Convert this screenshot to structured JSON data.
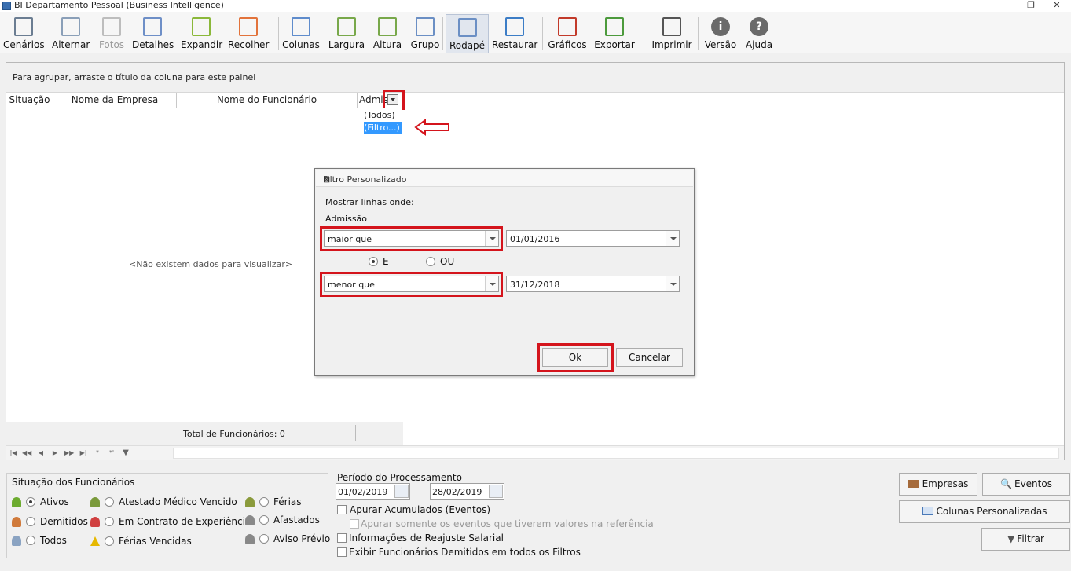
{
  "window": {
    "title": "BI Departamento Pessoal  (Business Intelligence)"
  },
  "toolbar": {
    "items": [
      {
        "label": "Cenários",
        "icon": "scenarios-icon"
      },
      {
        "label": "Alternar",
        "icon": "toggle-icon"
      },
      {
        "label": "Fotos",
        "icon": "photos-icon"
      },
      {
        "label": "Detalhes",
        "icon": "details-icon"
      },
      {
        "label": "Expandir",
        "icon": "expand-icon"
      },
      {
        "label": "Recolher",
        "icon": "collapse-icon"
      },
      {
        "label": "Colunas",
        "icon": "columns-icon"
      },
      {
        "label": "Largura",
        "icon": "width-icon"
      },
      {
        "label": "Altura",
        "icon": "height-icon"
      },
      {
        "label": "Grupo",
        "icon": "group-icon"
      },
      {
        "label": "Rodapé",
        "icon": "footer-icon"
      },
      {
        "label": "Restaurar",
        "icon": "restore-icon"
      },
      {
        "label": "Gráficos",
        "icon": "charts-icon"
      },
      {
        "label": "Exportar",
        "icon": "export-icon"
      },
      {
        "label": "Imprimir",
        "icon": "print-icon"
      },
      {
        "label": "Versão",
        "icon": "info-icon"
      },
      {
        "label": "Ajuda",
        "icon": "help-icon"
      }
    ]
  },
  "grid": {
    "group_panel_text": "Para agrupar, arraste o título da coluna para este painel",
    "columns": [
      "Situação",
      "Nome da Empresa",
      "Nome do Funcionário",
      "Admis"
    ],
    "filter_dropdown": [
      "(Todos)",
      "(Filtro...)"
    ],
    "empty_text": "<Não existem dados para visualizar>",
    "footer_text": "Total de Funcionários: 0"
  },
  "dialog": {
    "title": "Filtro Personalizado",
    "show_rows_label": "Mostrar linhas onde:",
    "field_label": "Admissão",
    "condition1": {
      "operator": "maior que",
      "value": "01/01/2016"
    },
    "logic": {
      "and_label": "E",
      "or_label": "OU",
      "selected": "E"
    },
    "condition2": {
      "operator": "menor que",
      "value": "31/12/2018"
    },
    "ok_label": "Ok",
    "cancel_label": "Cancelar"
  },
  "status_group": {
    "title": "Situação dos Funcionários",
    "options": [
      {
        "label": "Ativos",
        "selected": true
      },
      {
        "label": "Demitidos",
        "selected": false
      },
      {
        "label": "Todos",
        "selected": false
      },
      {
        "label": "Atestado Médico Vencido",
        "selected": false
      },
      {
        "label": "Em Contrato de Experiência",
        "selected": false
      },
      {
        "label": "Férias Vencidas",
        "selected": false
      },
      {
        "label": "Férias",
        "selected": false
      },
      {
        "label": "Afastados",
        "selected": false
      },
      {
        "label": "Aviso Prévio",
        "selected": false
      }
    ]
  },
  "period": {
    "title": "Período do Processamento",
    "start": "01/02/2019",
    "end": "28/02/2019",
    "checks": [
      "Apurar Acumulados (Eventos)",
      "Apurar somente os eventos que tiverem valores na referência",
      "Informações de Reajuste Salarial",
      "Exibir Funcionários Demitidos em todos os Filtros"
    ]
  },
  "buttons": {
    "empresas": "Empresas",
    "eventos": "Eventos",
    "colunas": "Colunas Personalizadas",
    "filtrar": "Filtrar"
  },
  "colors": {
    "highlight_red": "#d4141c",
    "selection_blue": "#3399ff"
  }
}
